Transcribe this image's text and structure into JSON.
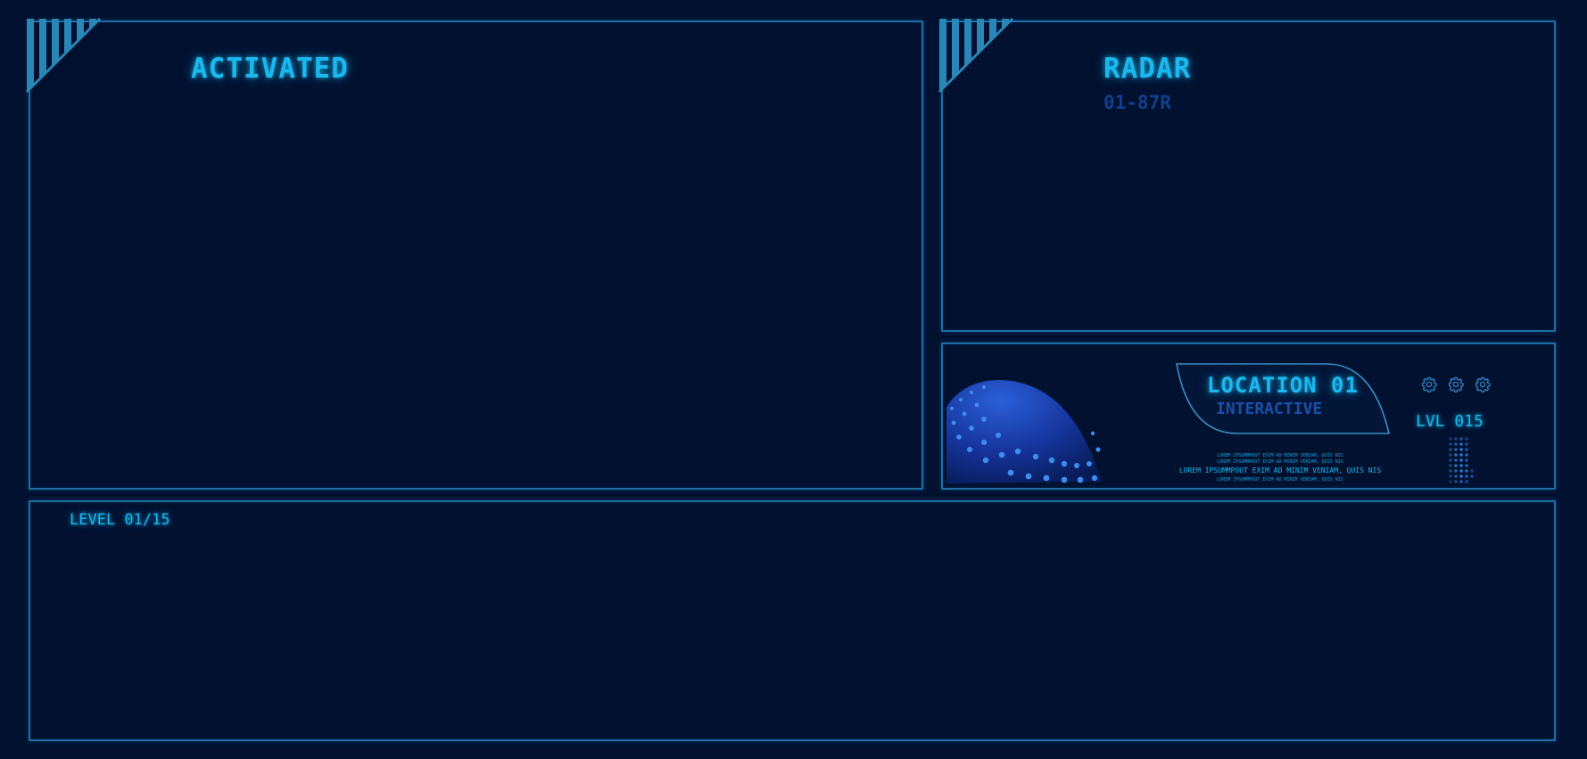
{
  "panels": {
    "activated": {
      "title": "ACTIVATED"
    },
    "radar": {
      "title": "RADAR",
      "code": "01-87R"
    },
    "location": {
      "title": "LOCATION 01",
      "subtitle": "INTERACTIVE",
      "level": "LVL 015",
      "caption_lines": [
        "LOREM IPSUMMPOUT EXIM AD MINIM VENIAM, QUIS NIS",
        "LOREM IPSUMMPOUT EXIM AD MINIM VENIAM, QUIS NIS",
        "LOREM IPSUMMPOUT EXIM AD MINIM VENIAM, QUIS NIS",
        "LOREM IPSUMMPOUT EXIM AD MINIM VENIAM, QUIS NIS"
      ],
      "icons": [
        "gear-icon",
        "gear-icon",
        "gear-icon"
      ]
    },
    "level": {
      "label": "LEVEL 01/15"
    }
  },
  "colors": {
    "background": "#021130",
    "border": "#1f6fa3",
    "accent": "#1ab8ee",
    "dim": "#12408e"
  }
}
